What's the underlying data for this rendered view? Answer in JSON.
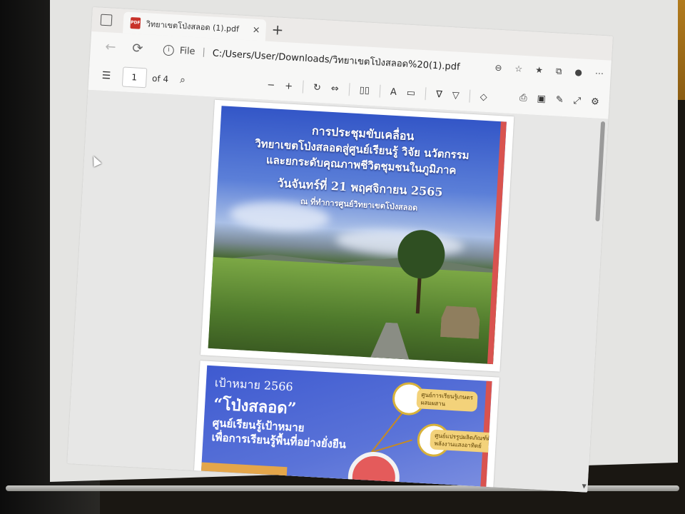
{
  "tab": {
    "title": "วิทยาเขตโป่งสลอด (1).pdf",
    "close_glyph": "×",
    "new_tab_glyph": "+"
  },
  "address": {
    "scheme": "File",
    "separator": "|",
    "url": "C:/Users/User/Downloads/วิทยาเขตโป่งสลอด%20(1).pdf"
  },
  "pdf_toolbar": {
    "current_page": "1",
    "page_count_label": "of 4"
  },
  "pages": {
    "slide1": {
      "line1": "การประชุมขับเคลื่อน",
      "line2": "วิทยาเขตโป่งสลอดสู่ศูนย์เรียนรู้ วิจัย นวัตกรรม",
      "line3": "และยกระดับคุณภาพชีวิตชุมชนในภูมิภาค",
      "line4": "วันจันทร์ที่ 21 พฤศจิกายน 2565",
      "line5": "ณ ที่ทำการศูนย์วิทยาเขตโป่งสลอด"
    },
    "slide2": {
      "goal": "เป้าหมาย 2566",
      "name": "“โป่งสลอด”",
      "line3": "ศูนย์เรียนรู้เป้าหมาย",
      "line4": "เพื่อการเรียนรู้พื้นที่อย่างยั่งยืน",
      "node1": "ศูนย์การเรียนรู้เกษตร\nผสมผสาน",
      "node2": "ศูนย์แปรรูปผลิตภัณฑ์ด้วย\nพลังงานแสงอาทิตย์"
    }
  },
  "icons": {
    "tab_actions": "tab-actions-icon",
    "back": "back-arrow-icon",
    "refresh": "refresh-icon",
    "info": "info-icon",
    "toc": "table-of-contents-icon",
    "find": "search-icon",
    "cursor": "mouse-cursor-icon"
  },
  "colors": {
    "slide_accent": "#d9534f",
    "pdf_icon": "#c8322a"
  }
}
